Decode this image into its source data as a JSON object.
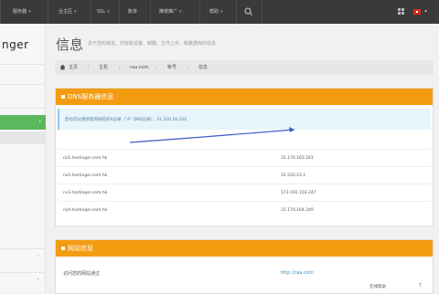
{
  "topbar": {
    "nav": [
      {
        "label": "服务器",
        "caret": "▾"
      },
      {
        "label": "业主区",
        "caret": "▾"
      },
      {
        "label": "SSL",
        "caret": "▾"
      },
      {
        "label": "账单",
        "caret": ""
      },
      {
        "label": "推荐推广",
        "caret": "▾"
      },
      {
        "label": "帮助",
        "caret": "▾"
      }
    ]
  },
  "sidebar": {
    "logo": "nger"
  },
  "page": {
    "title": "信息",
    "subtitle": "关于您的域名、托管和设置、邮箱、文件上传、和数据库的信息"
  },
  "breadcrumb": {
    "items": [
      "主页",
      "主机",
      "raa.com",
      "帐号",
      "信息"
    ]
  },
  "dns_panel": {
    "title": "DNS服务器信息",
    "notice": "您也可以更新您的域名的A记录（\"A\" DNS记录）：31.220.16.220",
    "records": [
      {
        "host": "ns1.hostinger.com.hk",
        "ip": "31.170.163.241"
      },
      {
        "host": "ns2.hostinger.com.hk",
        "ip": "31.220.23.1"
      },
      {
        "host": "ns3.hostinger.com.hk",
        "ip": "173.192.103.247"
      },
      {
        "host": "ns4.hostinger.com.hk",
        "ip": "31.170.164.249"
      }
    ]
  },
  "site_panel": {
    "title": "网站信息",
    "rows": [
      {
        "key": "访问您的网站通过",
        "value": "http://raa.com"
      }
    ]
  },
  "taskbar": {
    "item1": "在线帮助",
    "item2": "T"
  },
  "colors": {
    "accent": "#f39c12",
    "sidebar_active": "#5cb85c",
    "topbar": "#3a3a3a"
  }
}
